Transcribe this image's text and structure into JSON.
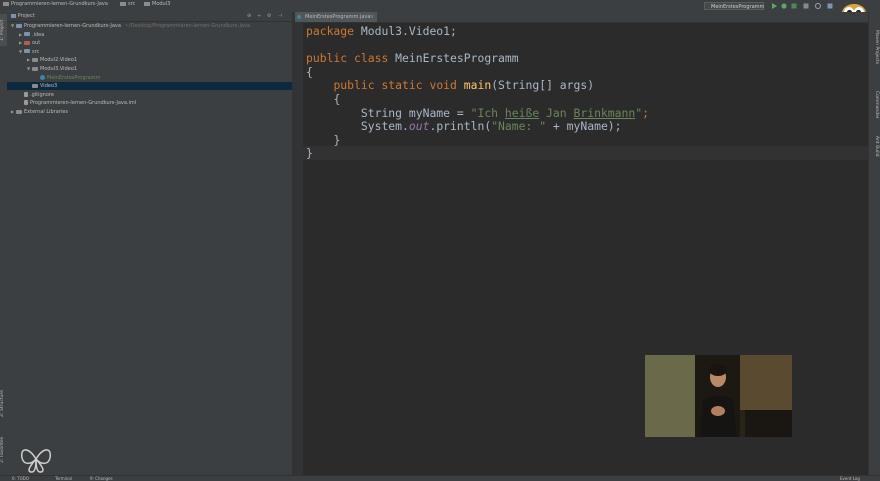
{
  "breadcrumb": [
    {
      "label": "Programmieren-lernen-Grundkurs-Java"
    },
    {
      "label": "src"
    },
    {
      "label": "Modul3"
    }
  ],
  "run_config": {
    "label": "MeinErstesProgramm"
  },
  "left_tabs": {
    "project": "1: Project",
    "structure": "Z: Structure",
    "favorites": "2: Favorites"
  },
  "right_tabs": {
    "maven": "Maven Projects",
    "commander": "Commander",
    "ant": "Ant Build"
  },
  "project_panel": {
    "header": "Project",
    "tree": [
      {
        "label": "Programmieren-lernen-Grundkurs-Java",
        "suffix": "~/Desktop/Programmieren-lernen-Grundkurs-Java",
        "depth": 0,
        "arrow": "▼",
        "icon": "folder-icon"
      },
      {
        "label": ".idea",
        "depth": 1,
        "arrow": "▶",
        "icon": "folder-icon"
      },
      {
        "label": "out",
        "depth": 1,
        "arrow": "▶",
        "icon": "folder-icon"
      },
      {
        "label": "src",
        "depth": 1,
        "arrow": "▼",
        "icon": "folder-icon"
      },
      {
        "label": "Modul2.Video1",
        "depth": 2,
        "arrow": "▶",
        "icon": "package-icon"
      },
      {
        "label": "Modul3.Video1",
        "depth": 2,
        "arrow": "▼",
        "icon": "package-icon"
      },
      {
        "label": "MeinErstesProgramm",
        "depth": 3,
        "arrow": "",
        "icon": "class-icon"
      },
      {
        "label": "Video3",
        "depth": 2,
        "arrow": "",
        "icon": "package-icon",
        "selected": true
      },
      {
        "label": ".gitignore",
        "depth": 1,
        "arrow": "",
        "icon": "file-icon"
      },
      {
        "label": "Programmieren-lernen-Grundkurs-Java.iml",
        "depth": 1,
        "arrow": "",
        "icon": "file-icon"
      },
      {
        "label": "External Libraries",
        "depth": 0,
        "arrow": "▶",
        "icon": "library-icon"
      }
    ]
  },
  "editor": {
    "tab_label": "MeinErstesProgramm.java",
    "code": {
      "l1_kw": "package",
      "l1_rest": " Modul3.Video1;",
      "l3_kw1": "public",
      "l3_kw2": "class",
      "l3_name": "MeinErstesProgramm",
      "l4": "{",
      "l5_kw1": "public",
      "l5_kw2": "static",
      "l5_kw3": "void",
      "l5_fn": "main",
      "l5_rest": "(String[] args)",
      "l6": "{",
      "l7_a": "String myName = ",
      "l7_s1": "\"Ich ",
      "l7_s2": "heiße",
      "l7_s3": " Jan ",
      "l7_s4": "Brinkmann",
      "l7_s5": "\"",
      "l7_end": ";",
      "l8_a": "System.",
      "l8_fld": "out",
      "l8_b": ".println(",
      "l8_str": "\"Name: \"",
      "l8_c": " + myName);",
      "l9": "}",
      "l10": "}"
    }
  },
  "statusbar": {
    "left1": "6: TODO",
    "left2": "Terminal",
    "left3": "9: Changes",
    "right": "Event Log"
  },
  "colors": {
    "background": "#2b2b2b",
    "panel": "#3c3f41",
    "selection": "#0d293e",
    "keyword": "#cc7832",
    "string": "#6a8759",
    "method": "#ffc66d"
  }
}
